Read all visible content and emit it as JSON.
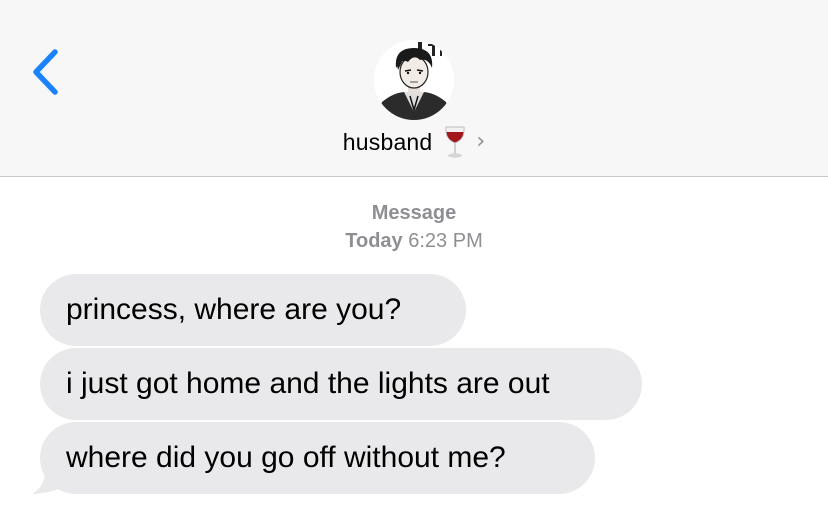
{
  "header": {
    "contact_name": "husband",
    "back_icon": "chevron-left-icon",
    "name_emoji_icon": "wine-glass-icon",
    "details_icon": "chevron-right-icon",
    "details_glyph": "›",
    "accent_color": "#1a82fb"
  },
  "conversation": {
    "service_label": "Message",
    "timestamp_day": "Today",
    "timestamp_time": "6:23 PM",
    "messages": [
      {
        "direction": "incoming",
        "text": "princess, where are you?"
      },
      {
        "direction": "incoming",
        "text": "i just got home and the lights are out"
      },
      {
        "direction": "incoming",
        "text": "where did you go off without me?"
      }
    ],
    "incoming_bubble_color": "#e9e9eb"
  }
}
